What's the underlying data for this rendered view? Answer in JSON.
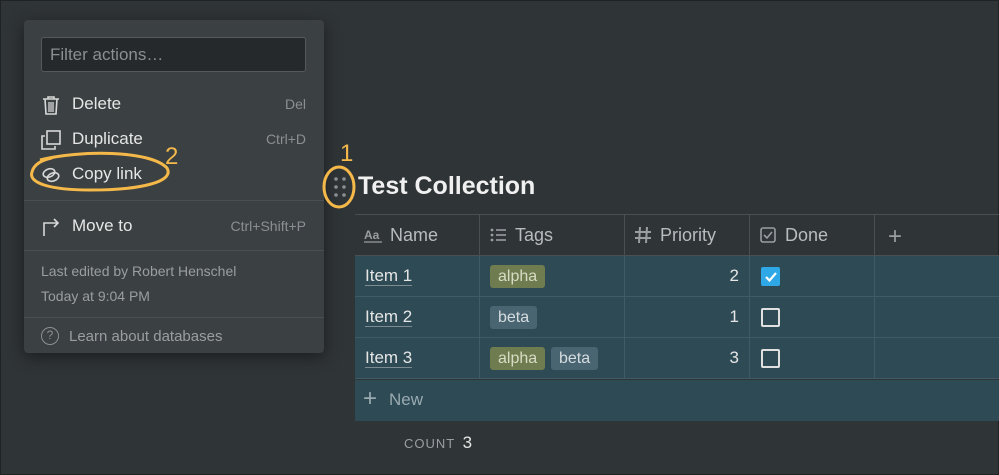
{
  "menu": {
    "filter_placeholder": "Filter actions…",
    "items": [
      {
        "label": "Delete",
        "shortcut": "Del",
        "icon": "trash-icon"
      },
      {
        "label": "Duplicate",
        "shortcut": "Ctrl+D",
        "icon": "duplicate-icon"
      },
      {
        "label": "Copy link",
        "shortcut": "",
        "icon": "link-icon"
      },
      {
        "label": "Move to",
        "shortcut": "Ctrl+Shift+P",
        "icon": "move-arrow-icon"
      }
    ],
    "last_edited": "Last edited by Robert Henschel",
    "edited_time": "Today at 9:04 PM",
    "learn": "Learn about databases"
  },
  "annotations": {
    "one": "1",
    "two": "2",
    "color": "#f5b94a"
  },
  "database": {
    "title": "Test Collection",
    "columns": [
      {
        "label": "Name",
        "icon": "text-property-icon"
      },
      {
        "label": "Tags",
        "icon": "list-icon"
      },
      {
        "label": "Priority",
        "icon": "hash-icon"
      },
      {
        "label": "Done",
        "icon": "checkbox-property-icon"
      }
    ],
    "add_column": "+",
    "rows": [
      {
        "name": "Item 1",
        "tags": [
          "alpha"
        ],
        "priority": "2",
        "done": true
      },
      {
        "name": "Item 2",
        "tags": [
          "beta"
        ],
        "priority": "1",
        "done": false
      },
      {
        "name": "Item 3",
        "tags": [
          "alpha",
          "beta"
        ],
        "priority": "3",
        "done": false
      }
    ],
    "new_label": "New",
    "count_label": "COUNT",
    "count_value": "3"
  },
  "colors": {
    "background": "#2f3437",
    "row": "#2d4a55",
    "alpha_tag": "#6f7c4f",
    "beta_tag": "#4a6572",
    "checked": "#2ea8e6"
  }
}
